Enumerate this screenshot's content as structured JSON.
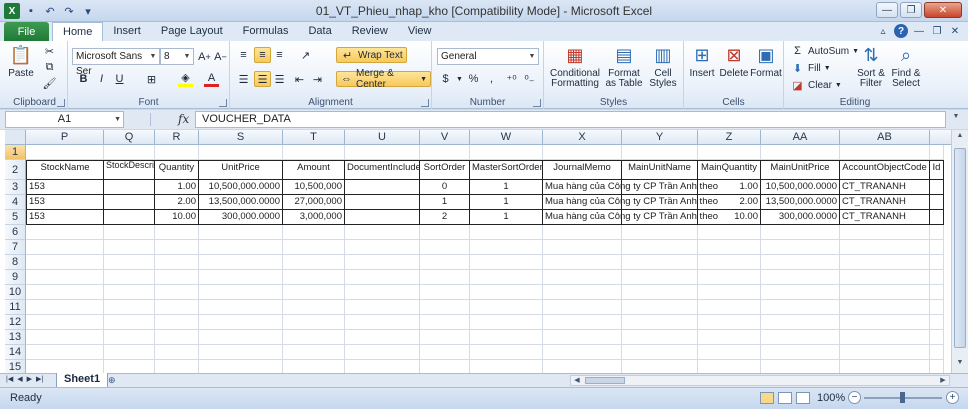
{
  "window": {
    "title": "01_VT_Phieu_nhap_kho  [Compatibility Mode]  -  Microsoft Excel"
  },
  "ribbon_tabs": [
    {
      "label": "File"
    },
    {
      "label": "Home",
      "active": true
    },
    {
      "label": "Insert"
    },
    {
      "label": "Page Layout"
    },
    {
      "label": "Formulas"
    },
    {
      "label": "Data"
    },
    {
      "label": "Review"
    },
    {
      "label": "View"
    }
  ],
  "clipboard": {
    "paste": "Paste",
    "group": "Clipboard"
  },
  "font": {
    "name": "Microsoft Sans Ser",
    "size": "8",
    "group": "Font",
    "bold": "B",
    "italic": "I",
    "underline": "U"
  },
  "alignment": {
    "wrap_text": "Wrap Text",
    "merge_center": "Merge & Center",
    "group": "Alignment"
  },
  "number": {
    "format": "General",
    "dollar": "$",
    "percent": "%",
    "comma": ",",
    "group": "Number"
  },
  "styles": {
    "conditional": "Conditional",
    "conditional2": "Formatting",
    "format_table": "Format",
    "format_table2": "as Table",
    "cell_styles": "Cell",
    "cell_styles2": "Styles",
    "group": "Styles"
  },
  "cells": {
    "insert": "Insert",
    "delete": "Delete",
    "format": "Format",
    "group": "Cells"
  },
  "editing": {
    "autosum": "AutoSum",
    "fill": "Fill",
    "clear": "Clear",
    "sort": "Sort &",
    "sort2": "Filter",
    "find": "Find &",
    "find2": "Select",
    "group": "Editing"
  },
  "formula_bar": {
    "name_box": "A1",
    "fx": "fx",
    "value": "VOUCHER_DATA"
  },
  "columns": [
    "P",
    "Q",
    "R",
    "S",
    "T",
    "U",
    "V",
    "W",
    "X",
    "Y",
    "Z",
    "AA",
    "AB"
  ],
  "rows": [
    "1",
    "2",
    "3",
    "4",
    "5",
    "6",
    "7",
    "8",
    "9",
    "10",
    "11",
    "12",
    "13",
    "14",
    "15"
  ],
  "table": {
    "headers": [
      "StockName",
      "StockDescription",
      "Quantity",
      "UnitPrice",
      "Amount",
      "DocumentIncluded",
      "SortOrder",
      "MasterSortOrder",
      "JournalMemo",
      "MainUnitName",
      "MainQuantity",
      "MainUnitPrice",
      "AccountObjectCode",
      "Id"
    ],
    "rows": [
      [
        "153",
        "",
        "1.00",
        "10,500,000.0000",
        "10,500,000",
        "",
        "0",
        "1",
        "Mua hàng của Công ty CP Trần Anh theo",
        "",
        "1.00",
        "10,500,000.0000",
        "CT_TRANANH"
      ],
      [
        "153",
        "",
        "2.00",
        "13,500,000.0000",
        "27,000,000",
        "",
        "1",
        "1",
        "Mua hàng của Công ty CP Trần Anh theo",
        "",
        "2.00",
        "13,500,000.0000",
        "CT_TRANANH"
      ],
      [
        "153",
        "",
        "10.00",
        "300,000.0000",
        "3,000,000",
        "",
        "2",
        "1",
        "Mua hàng của Công ty CP Trần Anh theo",
        "",
        "10.00",
        "300,000.0000",
        "CT_TRANANH"
      ]
    ]
  },
  "sheet_tabs": [
    {
      "label": "Sheet1"
    }
  ],
  "status": {
    "text": "Ready",
    "zoom": "100%",
    "zoom_minus": "−",
    "zoom_plus": "+"
  }
}
